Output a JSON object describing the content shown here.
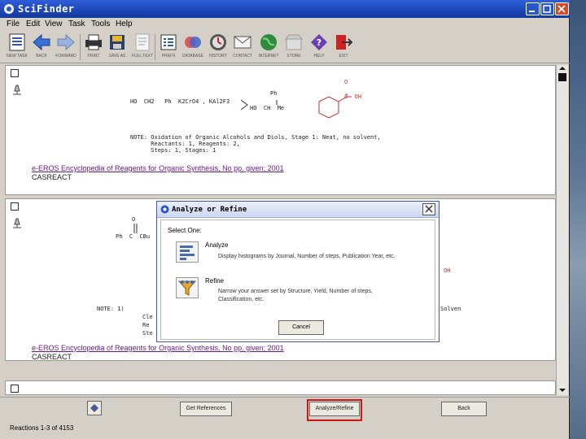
{
  "window": {
    "title": "SciFinder"
  },
  "menu": [
    "File",
    "Edit",
    "View",
    "Task",
    "Tools",
    "Help"
  ],
  "toolbar": [
    {
      "label": "NEW TASK",
      "icon": "new-task-icon"
    },
    {
      "label": "BACK",
      "icon": "back-arrow-icon"
    },
    {
      "label": "FORWARD",
      "icon": "forward-arrow-icon"
    },
    {
      "label": "PRINT",
      "icon": "printer-icon"
    },
    {
      "label": "SAVE AS",
      "icon": "save-icon"
    },
    {
      "label": "FULL TEXT",
      "icon": "full-text-icon"
    },
    {
      "label": "PREFS",
      "icon": "preferences-icon"
    },
    {
      "label": "DATABASE",
      "icon": "database-icon"
    },
    {
      "label": "HISTORY",
      "icon": "history-icon"
    },
    {
      "label": "CONTACT",
      "icon": "envelope-icon"
    },
    {
      "label": "INTERNET",
      "icon": "globe-icon"
    },
    {
      "label": "STORE",
      "icon": "store-icon"
    },
    {
      "label": "HELP",
      "icon": "help-icon"
    },
    {
      "label": "EXIT",
      "icon": "exit-icon"
    }
  ],
  "results": [
    {
      "reagents": "HO  CH2   Ph  K2CrO4 , KAl2F3",
      "note": "NOTE: Oxidation of Organic Alcohols and Diols, Stage 1: Neat, no solvent,\n      Reactants: 1, Reagents: 2,\n      Steps: 1, Stages: 1",
      "link": "e-EROS Encyclopedia of Reagents for Organic Synthesis, No pp. given; 2001",
      "source": "CASREACT"
    },
    {
      "reagents": "Ph  C  CBu",
      "note": "NOTE: 1)",
      "link": "e-EROS Encyclopedia of Reagents for Organic Synthesis, No pp. given; 2001",
      "source": "CASREACT"
    }
  ],
  "structure_labels": {
    "ph": "Ph",
    "ho_ch": "HO  CH  Me",
    "oh": "OH",
    "o": "O",
    "ch_oh": "C  OH"
  },
  "partial_text": {
    "note2_lines": [
      "Cle",
      "Re",
      "Ste"
    ],
    "trailing": "Solven",
    "oh2": "OH"
  },
  "bottom": {
    "get_references": "Get References",
    "analyze_refine": "Analyze/Refine",
    "back": "Back"
  },
  "status": "Reactions 1-3 of 4153",
  "dialog": {
    "title": "Analyze or Refine",
    "prompt": "Select One:",
    "analyze_title": "Analyze",
    "analyze_desc": "Display histograms by Journal, Number of steps, Publication Year, etc.",
    "refine_title": "Refine",
    "refine_desc_1": "Narrow your answer set by Structure, Yield, Number of steps,",
    "refine_desc_2": "Classification, etc.",
    "cancel": "Cancel"
  }
}
